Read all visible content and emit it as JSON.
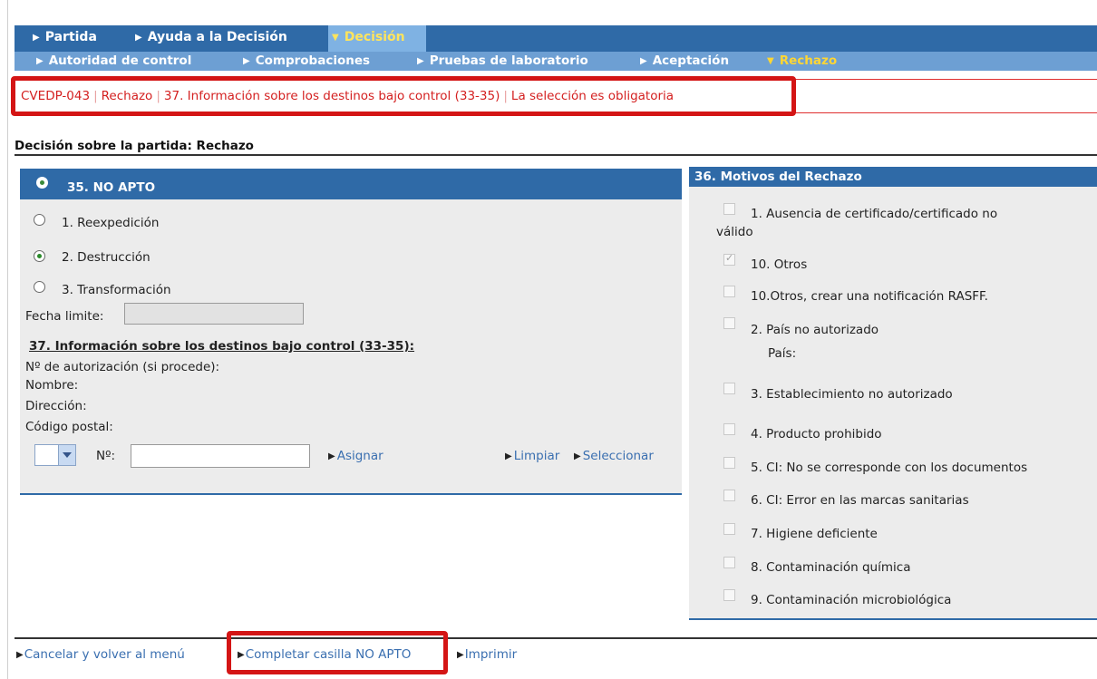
{
  "nav_primary": [
    {
      "label": "Partida",
      "active": false
    },
    {
      "label": "Ayuda a la Decisión",
      "active": false
    },
    {
      "label": "Decisión",
      "active": true
    }
  ],
  "nav_secondary": [
    {
      "label": "Autoridad de control",
      "active": false
    },
    {
      "label": "Comprobaciones",
      "active": false
    },
    {
      "label": "Pruebas de laboratorio",
      "active": false
    },
    {
      "label": "Aceptación",
      "active": false
    },
    {
      "label": "Rechazo",
      "active": true
    }
  ],
  "error": {
    "code": "CVEDP-043",
    "section": "Rechazo",
    "field": "37. Información sobre los destinos bajo control (33-35)",
    "message": "La selección es obligatoria"
  },
  "decision_title": "Decisión sobre la partida: Rechazo",
  "no_apto": {
    "header": "35. NO APTO",
    "options": [
      {
        "label": "1. Reexpedición",
        "selected": false
      },
      {
        "label": "2. Destrucción",
        "selected": true
      },
      {
        "label": "3. Transformación",
        "selected": false
      }
    ],
    "date_label": "Fecha limite:",
    "date_value": "",
    "destinations_title": "37. Información sobre los destinos bajo control (33-35):",
    "auth_label": "Nº de autorización (si procede):",
    "name_label": "Nombre:",
    "address_label": "Dirección:",
    "postal_label": "Código postal:",
    "select_value": "",
    "number_label": "Nº:",
    "number_value": "",
    "assign_label": "Asignar",
    "clear_label": "Limpiar",
    "select_label": "Seleccionar"
  },
  "motivos": {
    "header": "36. Motivos del Rechazo",
    "items": [
      {
        "label": "1. Ausencia de certificado/certificado no",
        "label_cont": "válido",
        "checked": false
      },
      {
        "label": "10. Otros",
        "checked": true
      },
      {
        "label": "10.Otros, crear una notificación RASFF.",
        "checked": false
      },
      {
        "label": "2. País no autorizado",
        "sub": "País:",
        "checked": false
      },
      {
        "label": "3. Establecimiento no autorizado",
        "checked": false
      },
      {
        "label": "4. Producto prohibido",
        "checked": false
      },
      {
        "label": "5. CI: No se corresponde con los documentos",
        "checked": false
      },
      {
        "label": "6. CI: Error en las marcas sanitarias",
        "checked": false
      },
      {
        "label": "7. Higiene deficiente",
        "checked": false
      },
      {
        "label": "8. Contaminación química",
        "checked": false
      },
      {
        "label": "9. Contaminación microbiológica",
        "checked": false
      }
    ]
  },
  "footer": {
    "cancel": "Cancelar y volver al menú",
    "complete": "Completar casilla NO APTO",
    "print": "Imprimir"
  },
  "colors": {
    "nav_primary": "#2f6aa7",
    "nav_secondary": "#6d9fd3",
    "active_nav": "#ffd633",
    "error": "#d42020",
    "highlight_box": "#d41515",
    "link": "#3a6fb0",
    "panel_bg": "#ececec"
  }
}
